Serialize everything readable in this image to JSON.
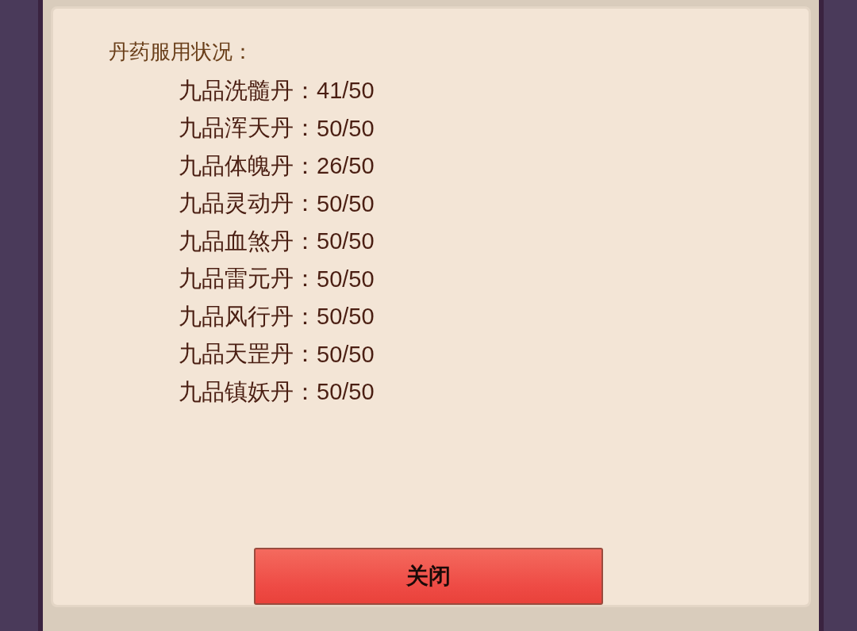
{
  "dialog": {
    "heading": "丹药服用状况：",
    "items": [
      {
        "name": "九品洗髓丹：",
        "count": "41/50"
      },
      {
        "name": "九品浑天丹：",
        "count": "50/50"
      },
      {
        "name": "九品体魄丹：",
        "count": "26/50"
      },
      {
        "name": "九品灵动丹：",
        "count": "50/50"
      },
      {
        "name": "九品血煞丹：",
        "count": "50/50"
      },
      {
        "name": "九品雷元丹：",
        "count": "50/50"
      },
      {
        "name": "九品风行丹：",
        "count": "50/50"
      },
      {
        "name": "九品天罡丹：",
        "count": "50/50"
      },
      {
        "name": "九品镇妖丹：",
        "count": "50/50"
      }
    ],
    "close_button": "关闭"
  }
}
